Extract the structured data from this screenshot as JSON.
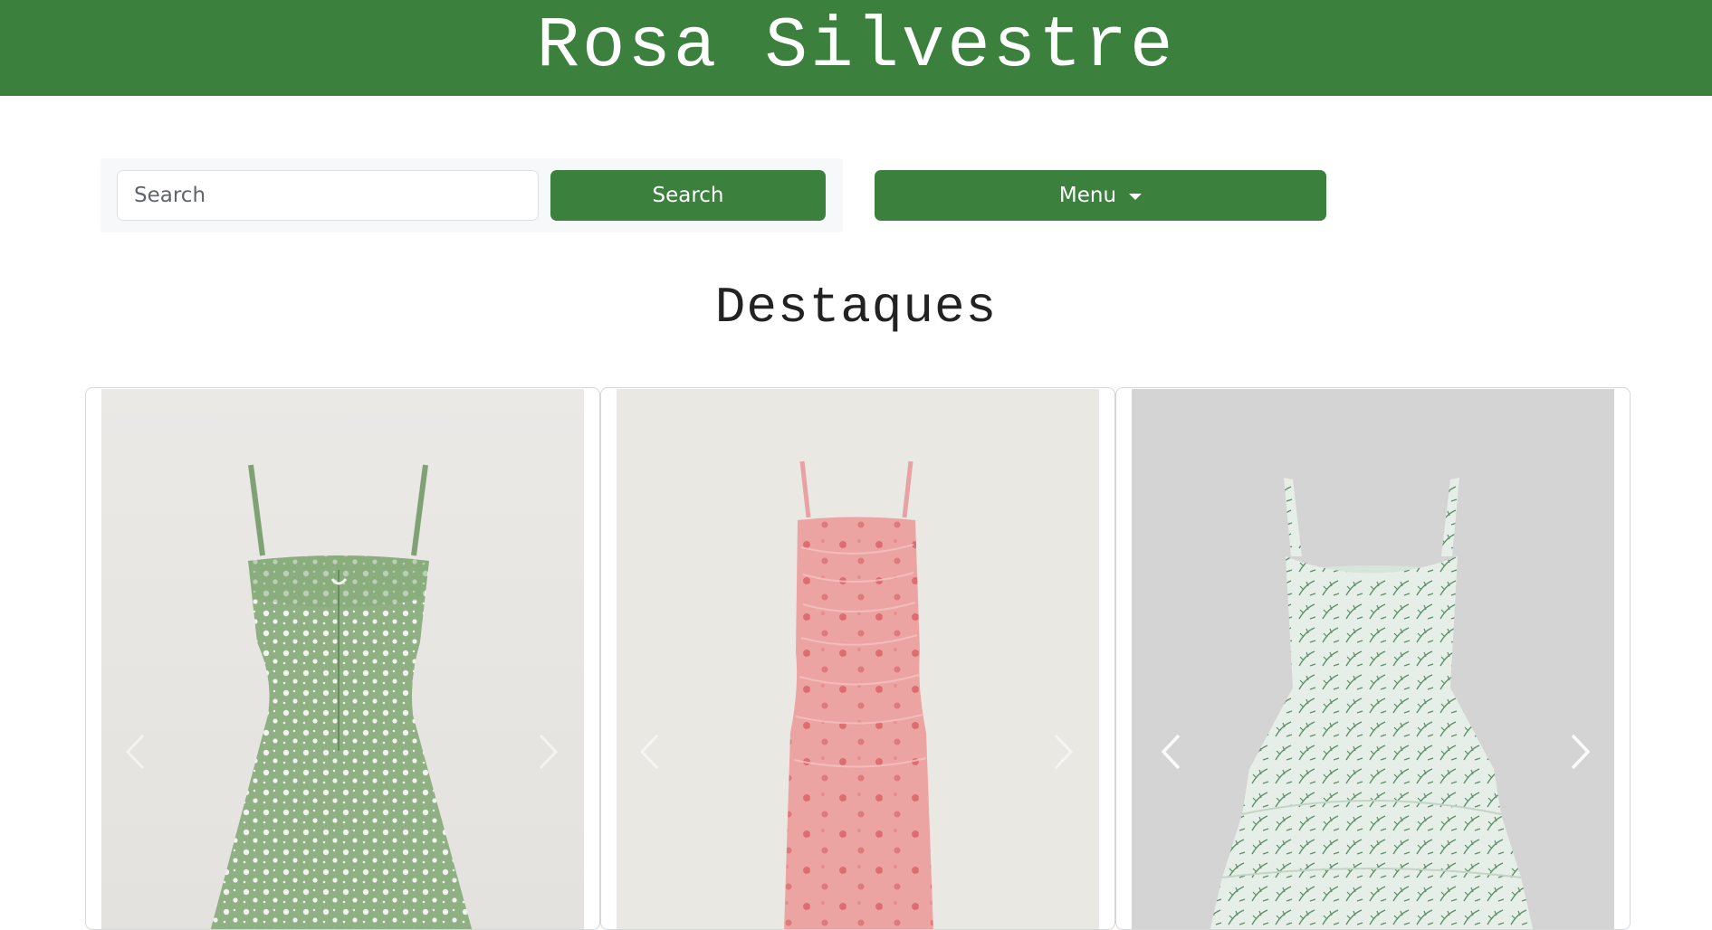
{
  "header": {
    "brand": "Rosa Silvestre"
  },
  "search": {
    "placeholder": "Search",
    "value": "",
    "button_label": "Search"
  },
  "menu": {
    "button_label": "Menu"
  },
  "featured": {
    "title": "Destaques",
    "cards": [
      {
        "product": "green floral mini dress",
        "background": "#e9e7e4",
        "dress_color": "#8fb083",
        "pattern_color": "#f1f4ee"
      },
      {
        "product": "pink rose maxi dress",
        "background": "#eae8e3",
        "dress_color": "#eca4a2",
        "pattern_color": "#d85b63"
      },
      {
        "product": "mint botanical tiered dress",
        "background": "#d3d3d3",
        "dress_color": "#e5efe7",
        "pattern_color": "#5d8d69"
      }
    ]
  },
  "colors": {
    "brand_green": "#3b803d"
  },
  "icons": {
    "previous": "chevron-left-icon",
    "next": "chevron-right-icon",
    "dropdown": "caret-down-icon"
  }
}
